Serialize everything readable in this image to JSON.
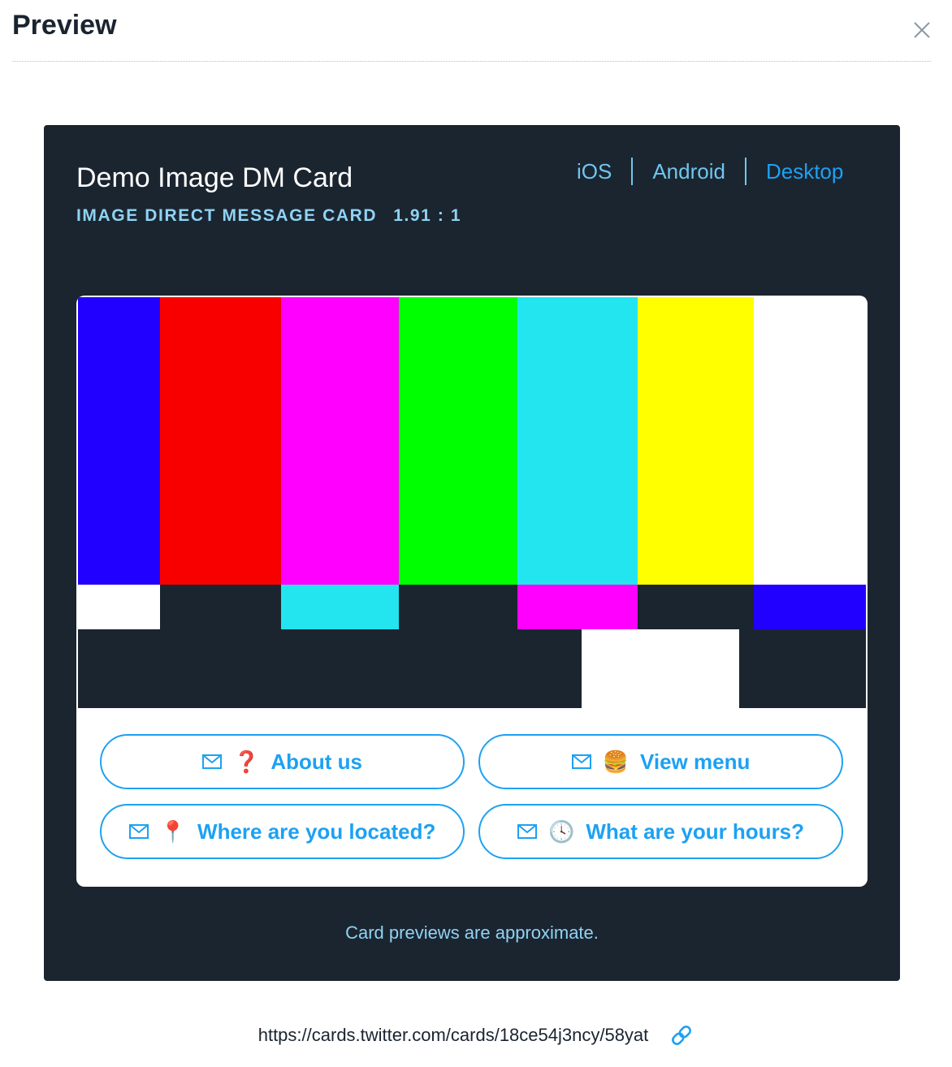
{
  "dialog": {
    "title": "Preview"
  },
  "card": {
    "name": "Demo Image DM Card",
    "type_label": "IMAGE DIRECT MESSAGE CARD",
    "aspect_ratio": "1.91 : 1"
  },
  "platform_tabs": {
    "items": [
      {
        "label": "iOS"
      },
      {
        "label": "Android"
      },
      {
        "label": "Desktop"
      }
    ],
    "active": "Desktop"
  },
  "test_pattern_colors": {
    "top": [
      "#2200ff",
      "#f80000",
      "#ff00ff",
      "#00ff00",
      "#22e5ef",
      "#ffff00",
      "#ffffff"
    ],
    "middle": [
      "#ffffff",
      "#1b2530",
      "#22e5ef",
      "#1b2530",
      "#ff00ff",
      "#1b2530",
      "#2200ff"
    ],
    "bottom_dark": "#1b2530",
    "bottom_white": "#ffffff"
  },
  "buttons": [
    {
      "icon": "mail-icon",
      "emoji": "❓",
      "label": "About us"
    },
    {
      "icon": "mail-icon",
      "emoji": "🍔",
      "label": "View menu"
    },
    {
      "icon": "mail-icon",
      "emoji": "📍",
      "label": "Where are you located?"
    },
    {
      "icon": "mail-icon",
      "emoji": "🕓",
      "label": "What are your hours?"
    }
  ],
  "disclaimer": "Card previews are approximate.",
  "card_url": "https://cards.twitter.com/cards/18ce54j3ncy/58yat",
  "colors": {
    "panel_bg": "#1b2530",
    "accent": "#1da1f2",
    "light_accent": "#8fd3f4"
  }
}
